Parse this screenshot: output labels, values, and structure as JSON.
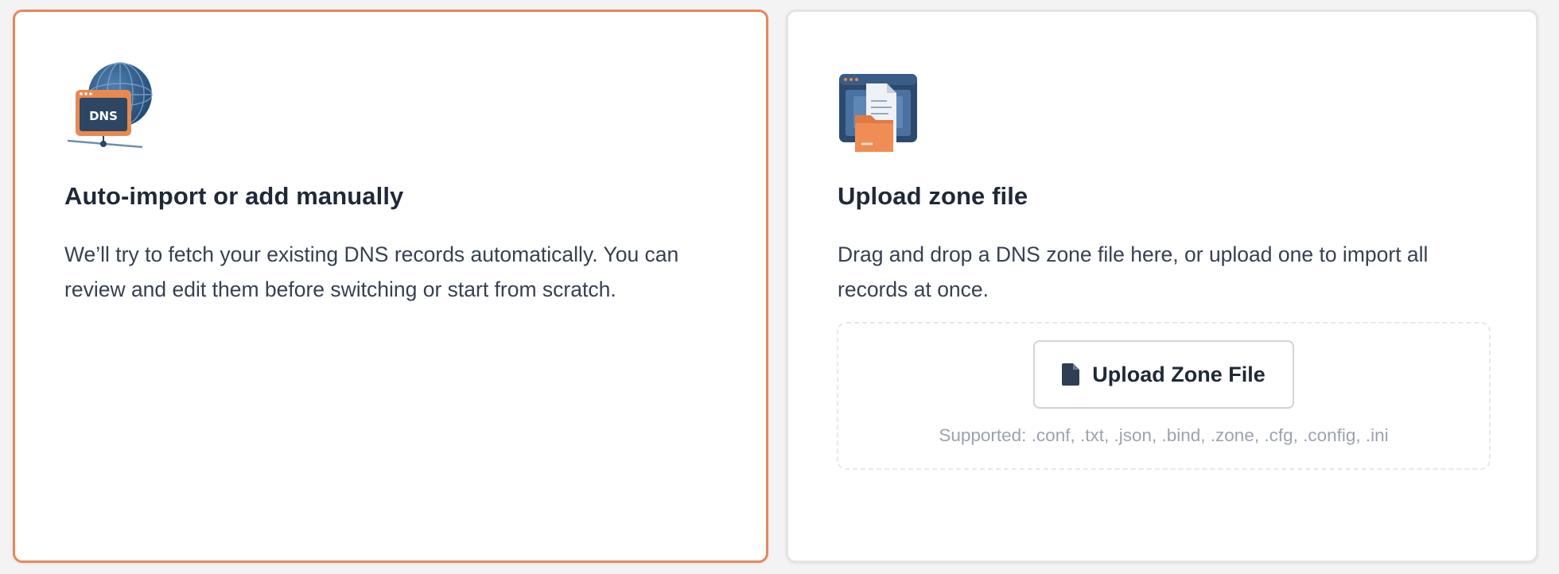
{
  "options": {
    "auto_import": {
      "title": "Auto-import or add manually",
      "description": "We’ll try to fetch your existing DNS records automatically. You can review and edit them before switching or start from scratch.",
      "illustration_text": "DNS",
      "icon": "dns-globe-icon",
      "selected": true
    },
    "upload": {
      "title": "Upload zone file",
      "description": "Drag and drop a DNS zone file here, or upload one to import all records at once.",
      "icon": "zone-file-folder-icon",
      "button_label": "Upload Zone File",
      "button_icon": "file-icon",
      "supported_text": "Supported: .conf, .txt, .json, .bind, .zone, .cfg, .config, .ini",
      "selected": false
    }
  },
  "colors": {
    "selected_border": "#e8875a",
    "card_border": "#e4e4e7",
    "title": "#1f2937",
    "text": "#374151",
    "muted": "#9ca3af"
  }
}
